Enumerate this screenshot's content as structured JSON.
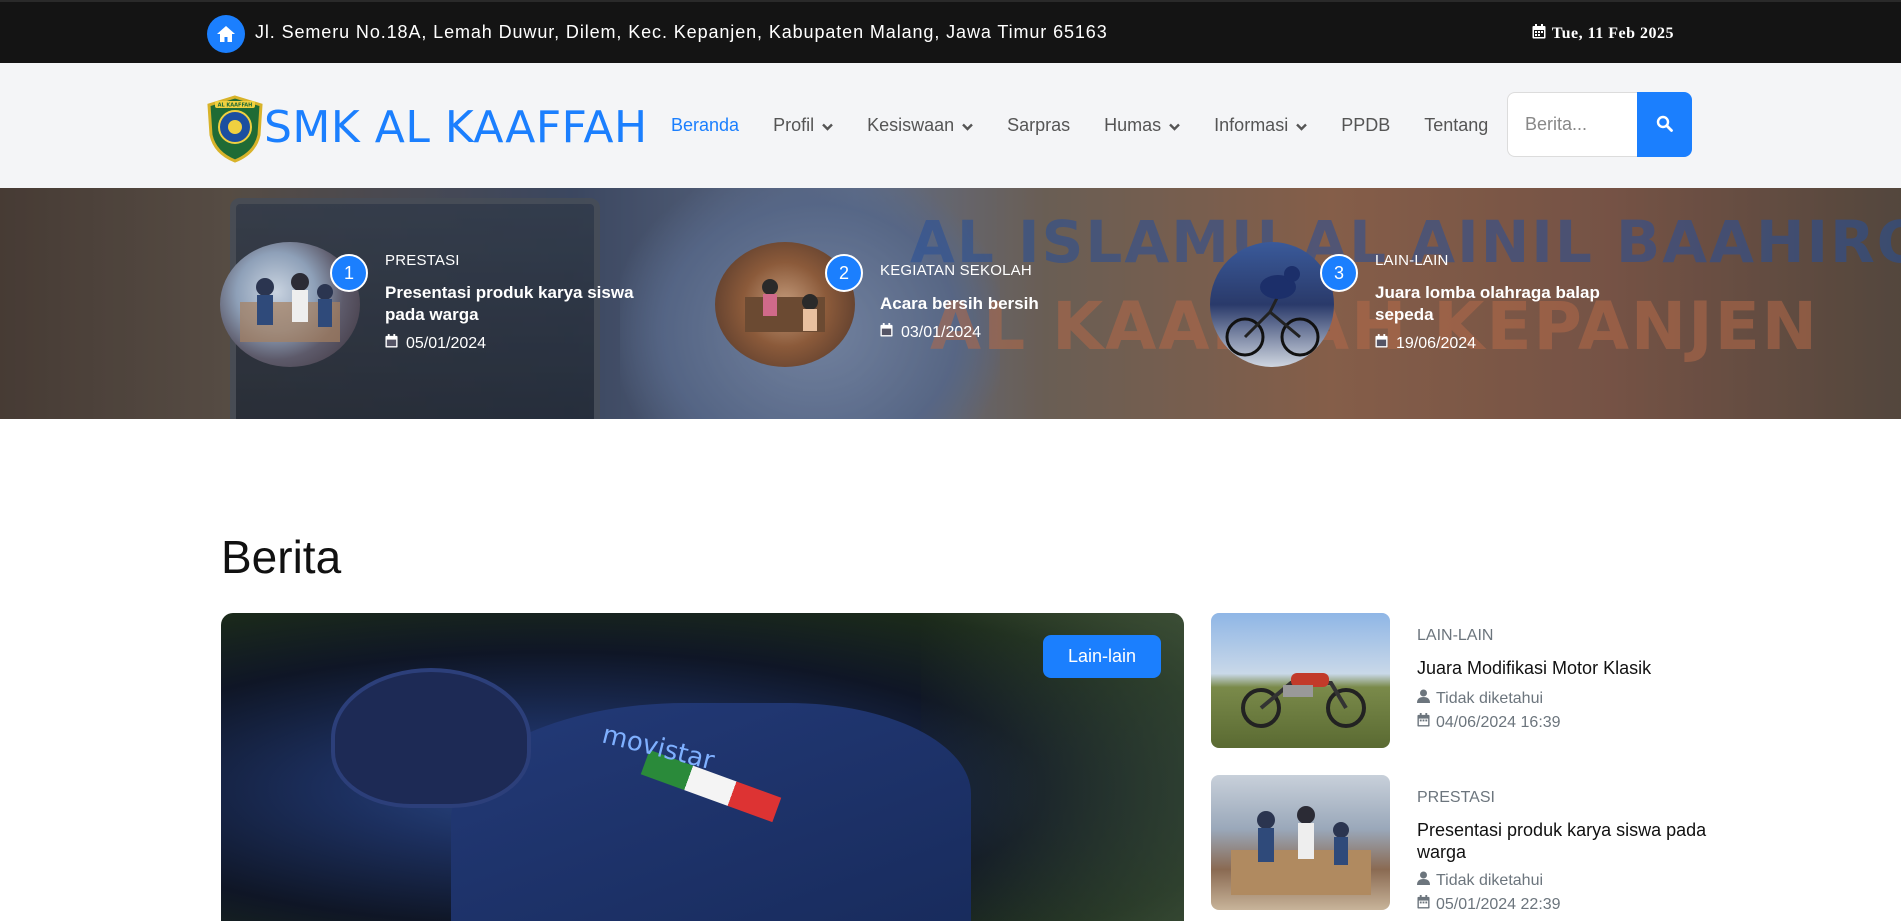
{
  "topbar": {
    "address": "Jl. Semeru No.18A, Lemah Duwur, Dilem, Kec. Kepanjen, Kabupaten Malang, Jawa Timur 65163",
    "date": "Tue, 11 Feb 2025",
    "home_icon": "home-icon",
    "calendar_icon": "calendar-icon"
  },
  "navbar": {
    "brand": "SMK AL KAAFFAH",
    "logo_text": "AL KAAFFAH",
    "items": [
      {
        "label": "Beranda",
        "active": true,
        "dropdown": false
      },
      {
        "label": "Profil",
        "active": false,
        "dropdown": true
      },
      {
        "label": "Kesiswaan",
        "active": false,
        "dropdown": true
      },
      {
        "label": "Sarpras",
        "active": false,
        "dropdown": false
      },
      {
        "label": "Humas",
        "active": false,
        "dropdown": true
      },
      {
        "label": "Informasi",
        "active": false,
        "dropdown": true
      },
      {
        "label": "PPDB",
        "active": false,
        "dropdown": false
      },
      {
        "label": "Tentang",
        "active": false,
        "dropdown": false
      }
    ],
    "search_placeholder": "Berita...",
    "search_icon": "search-icon"
  },
  "hero": {
    "background_text_1": "AL ISLAMU AL AINIL BAAHIROH",
    "background_text_2": "AL KAAFFAH KEPANJEN",
    "posts": [
      {
        "number": "1",
        "category": "PRESTASI",
        "title": "Presentasi produk karya siswa pada warga",
        "date": "05/01/2024"
      },
      {
        "number": "2",
        "category": "KEGIATAN SEKOLAH",
        "title": "Acara bersih bersih",
        "date": "03/01/2024"
      },
      {
        "number": "3",
        "category": "LAIN-LAIN",
        "title": "Juara lomba olahraga balap sepeda",
        "date": "19/06/2024"
      }
    ]
  },
  "berita": {
    "heading": "Berita",
    "featured": {
      "badge": "Lain-lain",
      "image_text": "movistar"
    },
    "side": [
      {
        "category": "LAIN-LAIN",
        "title": "Juara Modifikasi Motor Klasik",
        "author": "Tidak diketahui",
        "datetime": "04/06/2024 16:39"
      },
      {
        "category": "PRESTASI",
        "title": "Presentasi produk karya siswa pada warga",
        "author": "Tidak diketahui",
        "datetime": "05/01/2024 22:39"
      }
    ]
  },
  "colors": {
    "accent": "#1b7ffe",
    "topbar": "#141414",
    "navbar": "#f4f5f7"
  }
}
